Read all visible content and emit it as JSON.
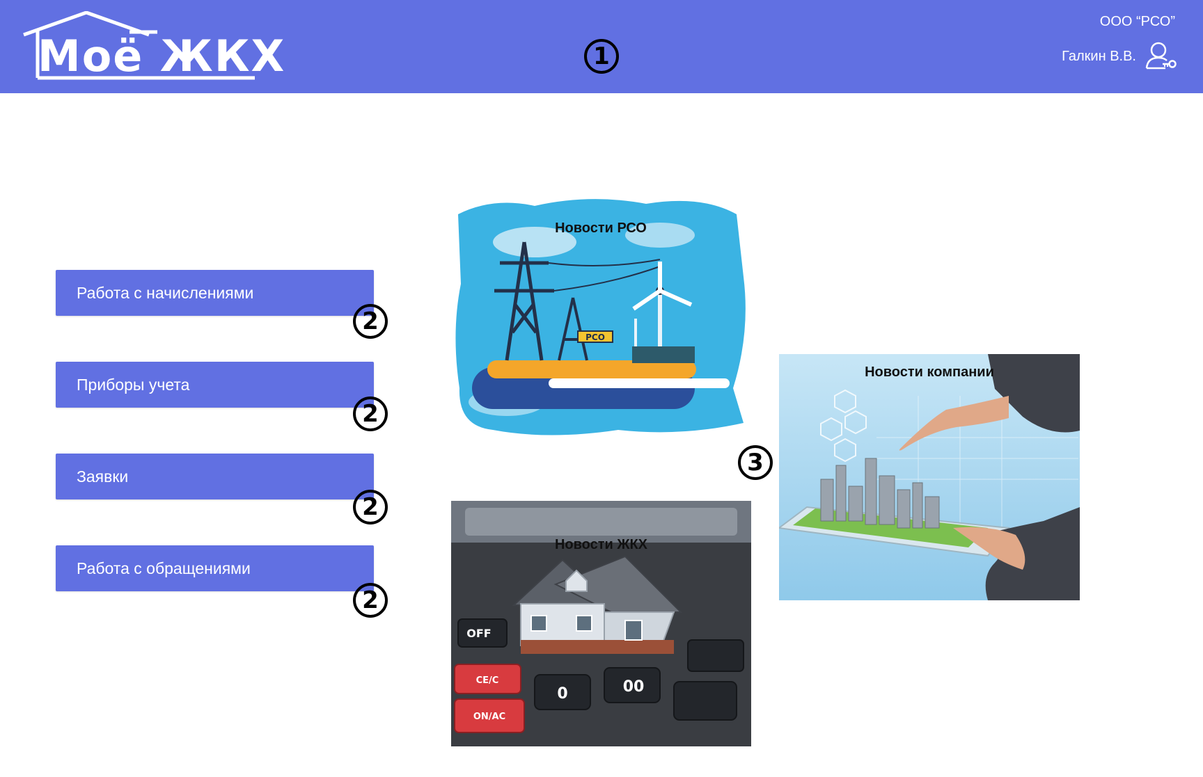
{
  "header": {
    "logo_text": "Моё ЖКХ",
    "org_name": "ООО “РСО”",
    "user_name": "Галкин В.В.",
    "user_icon": "user-key-icon",
    "background": "#6170e2"
  },
  "markers": {
    "one": "1",
    "two": "2",
    "three": "3"
  },
  "menu": {
    "items": [
      {
        "label": "Работа с начислениями"
      },
      {
        "label": "Приборы учета"
      },
      {
        "label": "Заявки"
      },
      {
        "label": "Работа с обращениями"
      }
    ]
  },
  "news": {
    "rso": {
      "title": "Новости РСО",
      "sign": "РСО"
    },
    "company": {
      "title": "Новости компании"
    },
    "zhkh": {
      "title": "Новости ЖКХ",
      "key_off": "OFF",
      "key_ce": "CE/C",
      "key_on": "ON/AC",
      "key_zero": "0",
      "key_double_zero": "00"
    }
  },
  "colors": {
    "accent": "#6170e2",
    "white": "#ffffff",
    "marker": "#000000"
  }
}
